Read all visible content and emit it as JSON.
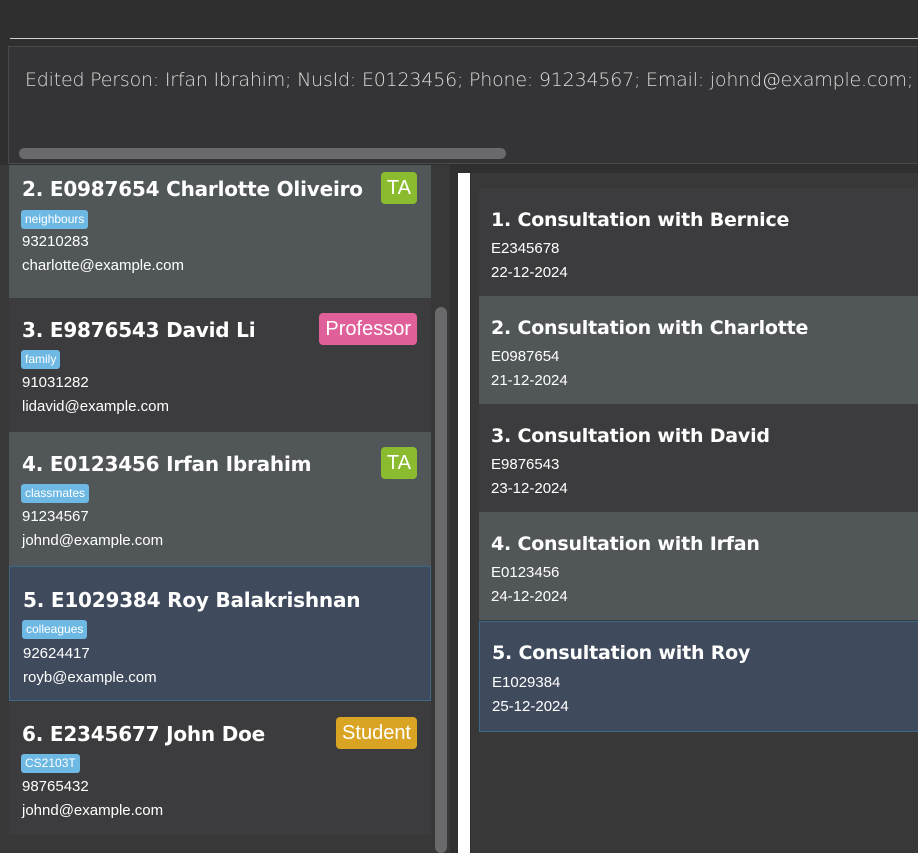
{
  "result_display": {
    "text": "Edited Person: Irfan Ibrahim; NusId: E0123456; Phone: 91234567; Email: johnd@example.com; Sch"
  },
  "persons": [
    {
      "title": "2.  E0987654  Charlotte Oliveiro",
      "tag": "neighbours",
      "phone": "93210283",
      "email": "charlotte@example.com",
      "role": "TA",
      "role_color": "#8bbb2e"
    },
    {
      "title": "3.  E9876543  David Li",
      "tag": "family",
      "phone": "91031282",
      "email": "lidavid@example.com",
      "role": "Professor",
      "role_color": "#e0609a"
    },
    {
      "title": "4.  E0123456  Irfan Ibrahim",
      "tag": "classmates",
      "phone": "91234567",
      "email": "johnd@example.com",
      "role": "TA",
      "role_color": "#8bbb2e"
    },
    {
      "title": "5.  E1029384  Roy Balakrishnan",
      "tag": "colleagues",
      "phone": "92624417",
      "email": "royb@example.com",
      "role": "",
      "role_color": ""
    },
    {
      "title": "6.  E2345677  John Doe",
      "tag": "CS2103T",
      "phone": "98765432",
      "email": "johnd@example.com",
      "role": "Student",
      "role_color": "#d9a424"
    }
  ],
  "consultations": [
    {
      "title": "1.  Consultation with Bernice",
      "id": "E2345678",
      "date": "22-12-2024"
    },
    {
      "title": "2.  Consultation with Charlotte",
      "id": "E0987654",
      "date": "21-12-2024"
    },
    {
      "title": "3.  Consultation with David",
      "id": "E9876543",
      "date": "23-12-2024"
    },
    {
      "title": "4.  Consultation with Irfan",
      "id": "E0123456",
      "date": "24-12-2024"
    },
    {
      "title": "5.  Consultation with Roy",
      "id": "E1029384",
      "date": "25-12-2024"
    }
  ]
}
